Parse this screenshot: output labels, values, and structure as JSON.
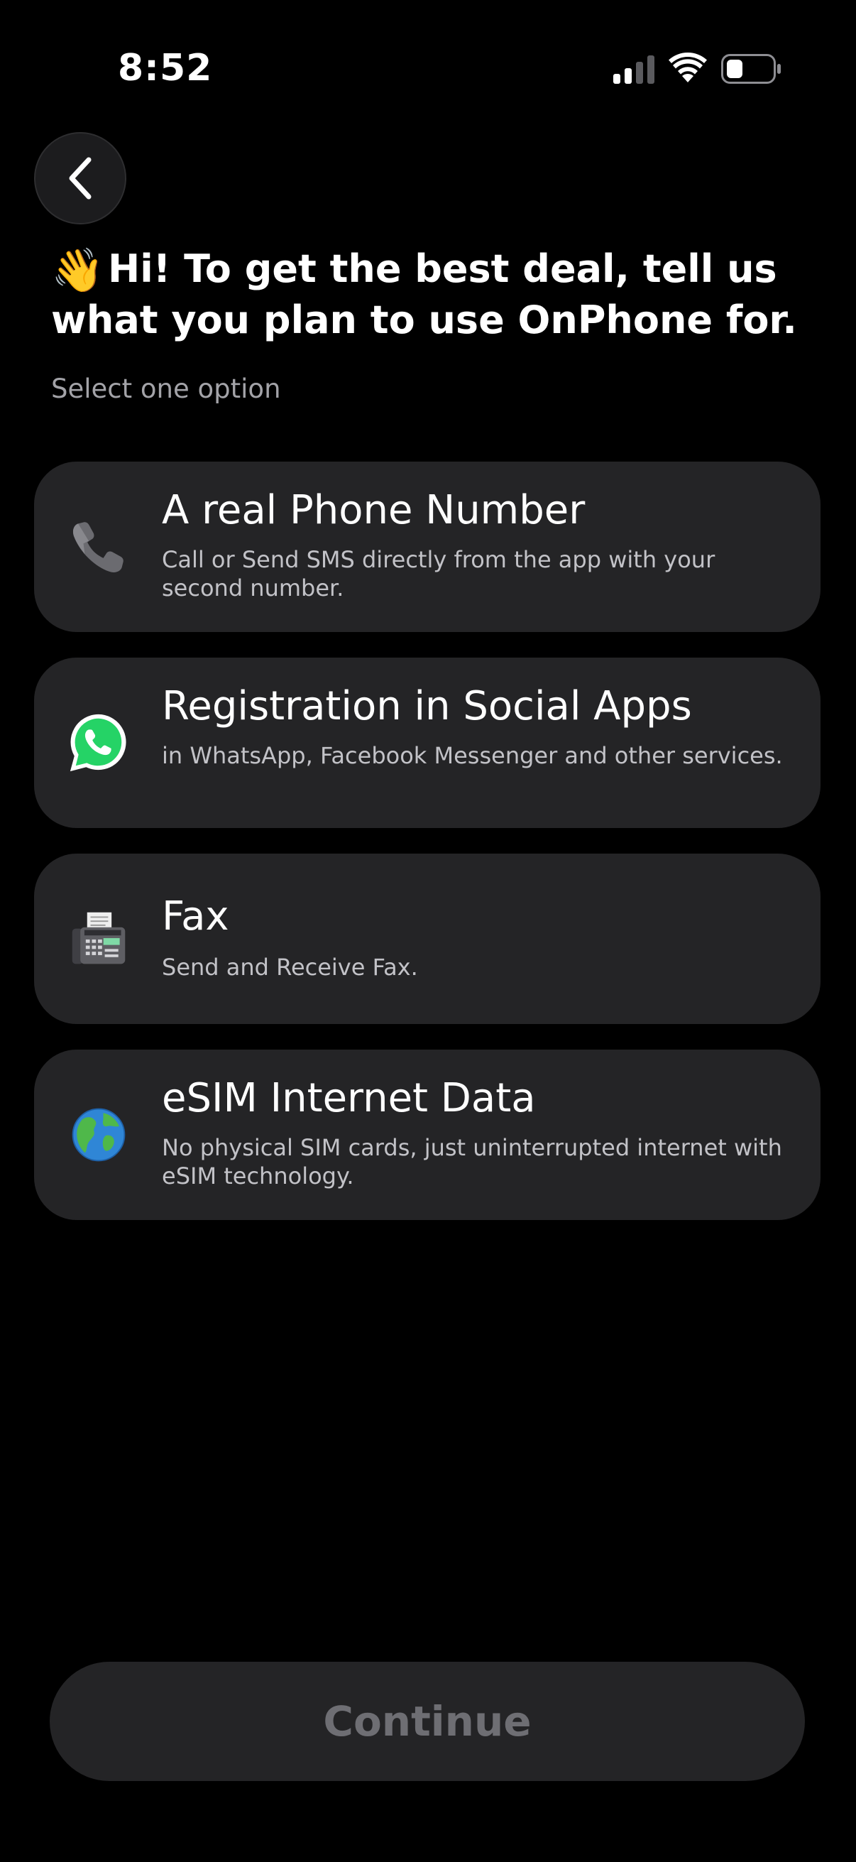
{
  "status_bar": {
    "time": "8:52",
    "icons": [
      "signal-icon",
      "wifi-icon",
      "battery-icon"
    ]
  },
  "back_button": {
    "icon": "chevron-left-icon"
  },
  "header": {
    "emoji": "👋",
    "title": "Hi! To get the best deal, tell us what you plan to use OnPhone for.",
    "subtitle": "Select one option"
  },
  "options": [
    {
      "icon": "telephone-icon",
      "title": "A real Phone Number",
      "description": "Call or Send SMS directly from the app with your second number."
    },
    {
      "icon": "whatsapp-icon",
      "title": "Registration in Social Apps",
      "description": "in WhatsApp, Facebook Messenger and other services."
    },
    {
      "icon": "fax-icon",
      "title": "Fax",
      "description": "Send and Receive Fax."
    },
    {
      "icon": "globe-icon",
      "title": "eSIM Internet Data",
      "description": "No physical SIM cards, just uninterrupted internet with eSIM technology."
    }
  ],
  "continue_button": {
    "label": "Continue"
  },
  "colors": {
    "background": "#000000",
    "card": "#242426",
    "disabled_text": "#6e6e73",
    "whatsapp_green": "#25D366"
  }
}
